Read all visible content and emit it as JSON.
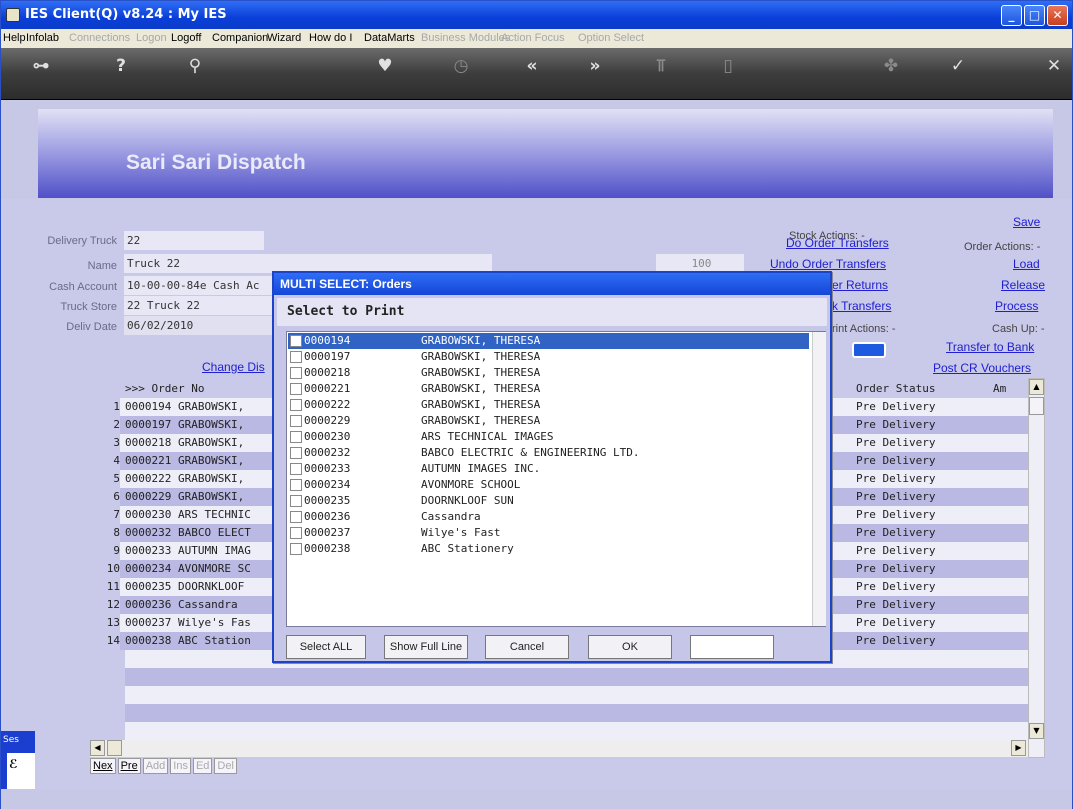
{
  "window": {
    "title": "IES Client(Q) v8.24 : My IES"
  },
  "menu": [
    {
      "label": "Help",
      "enabled": true
    },
    {
      "label": "Infolab",
      "enabled": true
    },
    {
      "label": "Connections",
      "enabled": false
    },
    {
      "label": "Logon",
      "enabled": false
    },
    {
      "label": "Logoff",
      "enabled": true
    },
    {
      "label": "Companion",
      "enabled": true
    },
    {
      "label": "Wizard",
      "enabled": true
    },
    {
      "label": "How do I",
      "enabled": true
    },
    {
      "label": "DataMarts",
      "enabled": true
    },
    {
      "label": "Business Modules",
      "enabled": false
    },
    {
      "label": "Action Focus",
      "enabled": false
    },
    {
      "label": "Option Select",
      "enabled": false
    }
  ],
  "toolbar": {
    "icons": [
      "key-icon",
      "help-icon",
      "search-icon",
      "heart-icon",
      "clock-icon",
      "back-icon",
      "forward-icon",
      "tools-icon",
      "document-icon",
      "globe-icon",
      "check-icon",
      "close-icon"
    ],
    "glyphs": [
      "⊶",
      "?",
      "⚲",
      "♥",
      "◷",
      "«",
      "»",
      "⫪",
      "▯",
      "✤",
      "✓",
      "✕"
    ]
  },
  "banner": {
    "title": "Sari Sari Dispatch"
  },
  "form": {
    "delivery_truck_label": "Delivery Truck",
    "delivery_truck_value": "22",
    "name_label": "Name",
    "name_value": "Truck 22",
    "cash_account_label": "Cash Account",
    "cash_account_value": "10-00-00-84e Cash Ac",
    "truck_store_label": "Truck Store",
    "truck_store_value": "22 Truck 22",
    "deliv_date_label": "Deliv Date",
    "deliv_date_value": "06/02/2010",
    "hidden_value": "100",
    "change_link": "Change Dis"
  },
  "actions": {
    "stock_label": "Stock Actions: -",
    "do_order_transfers": "Do Order Transfers",
    "undo_order_transfers": "Undo Order Transfers",
    "order_returns": "er Returns",
    "k_transfers": "k Transfers",
    "print_label": "rint Actions: -",
    "save": "Save",
    "order_actions_label": "Order Actions: -",
    "load": "Load",
    "release": "Release",
    "process": "Process",
    "cash_up_label": "Cash Up: -",
    "transfer_to_bank": "Transfer to Bank",
    "post_cr_vouchers": "Post CR Vouchers"
  },
  "grid": {
    "header_order": ">>> Order No",
    "header_status": "Order Status",
    "header_amount": "Am",
    "rows": [
      {
        "n": "1",
        "order": "0000194 GRABOWSKI,",
        "status": "Pre Delivery"
      },
      {
        "n": "2",
        "order": "0000197 GRABOWSKI,",
        "status": "Pre Delivery"
      },
      {
        "n": "3",
        "order": "0000218 GRABOWSKI,",
        "status": "Pre Delivery"
      },
      {
        "n": "4",
        "order": "0000221 GRABOWSKI,",
        "status": "Pre Delivery"
      },
      {
        "n": "5",
        "order": "0000222 GRABOWSKI,",
        "status": "Pre Delivery"
      },
      {
        "n": "6",
        "order": "0000229 GRABOWSKI,",
        "status": "Pre Delivery"
      },
      {
        "n": "7",
        "order": "0000230 ARS TECHNIC",
        "status": "Pre Delivery"
      },
      {
        "n": "8",
        "order": "0000232 BABCO ELECT",
        "status": "Pre Delivery"
      },
      {
        "n": "9",
        "order": "0000233 AUTUMN IMAG",
        "status": "Pre Delivery"
      },
      {
        "n": "10",
        "order": "0000234 AVONMORE SC",
        "status": "Pre Delivery"
      },
      {
        "n": "11",
        "order": "0000235 DOORNKLOOF",
        "status": "Pre Delivery"
      },
      {
        "n": "12",
        "order": "0000236 Cassandra",
        "status": "Pre Delivery"
      },
      {
        "n": "13",
        "order": "0000237 Wilye's Fas",
        "status": "Pre Delivery"
      },
      {
        "n": "14",
        "order": "0000238 ABC Station",
        "status": "Pre Delivery"
      }
    ]
  },
  "nav_buttons": [
    {
      "label": "Nex",
      "enabled": true
    },
    {
      "label": "Pre",
      "enabled": true
    },
    {
      "label": "Add",
      "enabled": false
    },
    {
      "label": "Ins",
      "enabled": false
    },
    {
      "label": "Ed",
      "enabled": false
    },
    {
      "label": "Del",
      "enabled": false
    }
  ],
  "sidebar_label": "Ses",
  "modal": {
    "title": "MULTI SELECT: Orders",
    "header": "Select to Print",
    "items": [
      {
        "id": "0000194",
        "name": "GRABOWSKI, THERESA",
        "selected": true
      },
      {
        "id": "0000197",
        "name": "GRABOWSKI, THERESA",
        "selected": false
      },
      {
        "id": "0000218",
        "name": "GRABOWSKI, THERESA",
        "selected": false
      },
      {
        "id": "0000221",
        "name": "GRABOWSKI, THERESA",
        "selected": false
      },
      {
        "id": "0000222",
        "name": "GRABOWSKI, THERESA",
        "selected": false
      },
      {
        "id": "0000229",
        "name": "GRABOWSKI, THERESA",
        "selected": false
      },
      {
        "id": "0000230",
        "name": "ARS TECHNICAL IMAGES",
        "selected": false
      },
      {
        "id": "0000232",
        "name": "BABCO ELECTRIC & ENGINEERING LTD.",
        "selected": false
      },
      {
        "id": "0000233",
        "name": "AUTUMN IMAGES INC.",
        "selected": false
      },
      {
        "id": "0000234",
        "name": "AVONMORE SCHOOL",
        "selected": false
      },
      {
        "id": "0000235",
        "name": "DOORNKLOOF SUN",
        "selected": false
      },
      {
        "id": "0000236",
        "name": "Cassandra",
        "selected": false
      },
      {
        "id": "0000237",
        "name": "Wilye's Fast",
        "selected": false
      },
      {
        "id": "0000238",
        "name": "ABC Stationery",
        "selected": false
      }
    ],
    "buttons": {
      "select_all": "Select ALL",
      "show_full_line": "Show Full Line",
      "cancel": "Cancel",
      "ok": "OK"
    }
  }
}
